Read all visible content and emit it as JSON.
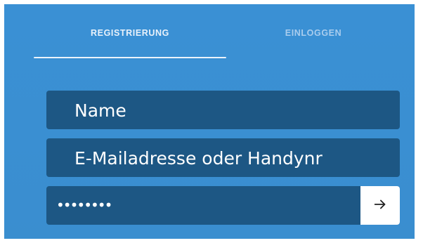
{
  "tabs": {
    "register": "REGISTRIERUNG",
    "login": "EINLOGGEN",
    "active": "register"
  },
  "form": {
    "name": "Name",
    "email": "E-Mailadresse oder Handynr",
    "password": "••••••••",
    "submit_icon": "arrow-right-icon"
  },
  "colors": {
    "background": "#3a8fd2",
    "field": "#1d5784",
    "button": "#ffffff"
  }
}
